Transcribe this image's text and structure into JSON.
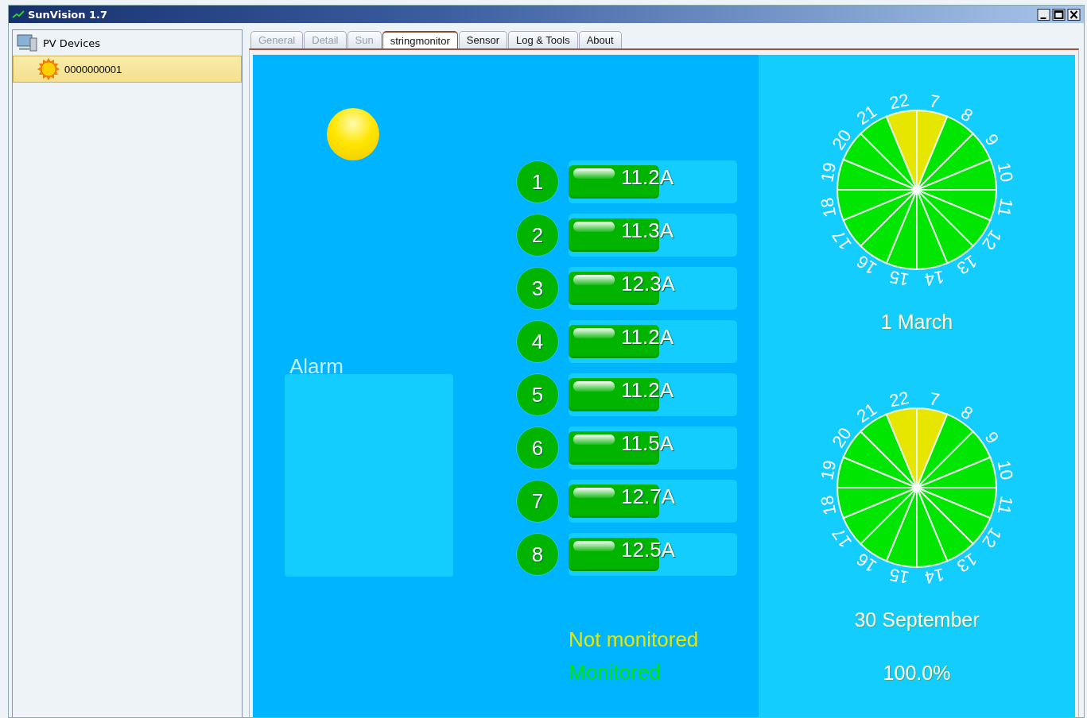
{
  "window": {
    "title": "SunVision 1.7"
  },
  "sidebar": {
    "root": {
      "label": "PV Devices",
      "children": [
        {
          "label": "0000000001",
          "selected": true
        }
      ]
    }
  },
  "tabs": [
    {
      "label": "General",
      "selected": false,
      "disabled": true
    },
    {
      "label": "Detail",
      "selected": false,
      "disabled": true
    },
    {
      "label": "Sun",
      "selected": false,
      "disabled": true
    },
    {
      "label": "stringmonitor",
      "selected": true,
      "disabled": false
    },
    {
      "label": "Sensor",
      "selected": false,
      "disabled": false
    },
    {
      "label": "Log & Tools",
      "selected": false,
      "disabled": false
    },
    {
      "label": "About",
      "selected": false,
      "disabled": false
    }
  ],
  "stringmonitor": {
    "alarm_label": "Alarm",
    "strings": [
      {
        "number": "1",
        "reading": "11.2A"
      },
      {
        "number": "2",
        "reading": "11.3A"
      },
      {
        "number": "3",
        "reading": "12.3A"
      },
      {
        "number": "4",
        "reading": "11.2A"
      },
      {
        "number": "5",
        "reading": "11.2A"
      },
      {
        "number": "6",
        "reading": "11.5A"
      },
      {
        "number": "7",
        "reading": "12.7A"
      },
      {
        "number": "8",
        "reading": "12.5A"
      }
    ],
    "legend": [
      {
        "label": "Not monitored",
        "color": "#e6e600"
      },
      {
        "label": "Monitored",
        "color": "#00e600"
      }
    ],
    "dials": [
      {
        "caption": "1 March",
        "hours": [
          {
            "label": "7",
            "monitored": false
          },
          {
            "label": "8",
            "monitored": true
          },
          {
            "label": "9",
            "monitored": true
          },
          {
            "label": "10",
            "monitored": true
          },
          {
            "label": "11",
            "monitored": true
          },
          {
            "label": "12",
            "monitored": true
          },
          {
            "label": "13",
            "monitored": true
          },
          {
            "label": "14",
            "monitored": true
          },
          {
            "label": "15",
            "monitored": true
          },
          {
            "label": "16",
            "monitored": true
          },
          {
            "label": "17",
            "monitored": true
          },
          {
            "label": "18",
            "monitored": true
          },
          {
            "label": "19",
            "monitored": true
          },
          {
            "label": "20",
            "monitored": true
          },
          {
            "label": "21",
            "monitored": true
          },
          {
            "label": "22",
            "monitored": false
          }
        ]
      },
      {
        "caption": "30 September",
        "hours": [
          {
            "label": "7",
            "monitored": false
          },
          {
            "label": "8",
            "monitored": true
          },
          {
            "label": "9",
            "monitored": true
          },
          {
            "label": "10",
            "monitored": true
          },
          {
            "label": "11",
            "monitored": true
          },
          {
            "label": "12",
            "monitored": true
          },
          {
            "label": "13",
            "monitored": true
          },
          {
            "label": "14",
            "monitored": true
          },
          {
            "label": "15",
            "monitored": true
          },
          {
            "label": "16",
            "monitored": true
          },
          {
            "label": "17",
            "monitored": true
          },
          {
            "label": "18",
            "monitored": true
          },
          {
            "label": "19",
            "monitored": true
          },
          {
            "label": "20",
            "monitored": true
          },
          {
            "label": "21",
            "monitored": true
          },
          {
            "label": "22",
            "monitored": false
          }
        ]
      }
    ],
    "percentage": "100.0%"
  }
}
